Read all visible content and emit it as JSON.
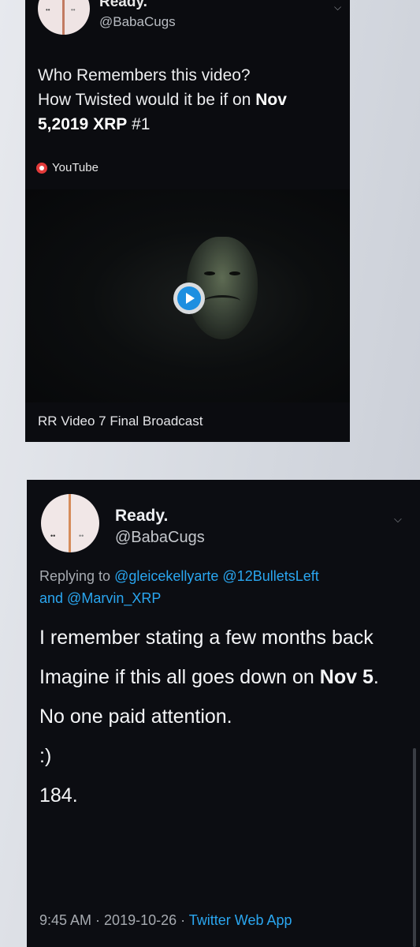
{
  "tweet1": {
    "name": "Ready.",
    "handle": "@BabaCugs",
    "text_line1": "Who Remembers this video?",
    "text_line2_plain": "How Twisted would it be if on ",
    "text_line2_bold": "Nov",
    "text_line3_bold1": "5,2019",
    "text_line3_bold2": "XRP",
    "text_line3_plain": " #1",
    "source_label": "YouTube",
    "video_title": "RR Video 7 Final Broadcast"
  },
  "tweet2": {
    "name": "Ready.",
    "handle": "@BabaCugs",
    "reply_prefix": "Replying to ",
    "reply_mention1": "@gleicekellyarte",
    "reply_mention2": "@12BulletsLeft",
    "reply_and": "and ",
    "reply_mention3": "@Marvin_XRP",
    "line1": "I remember stating a few months back",
    "line2_plain": "Imagine if this all goes down on ",
    "line2_bold": "Nov 5",
    "line2_end": ".",
    "line3": "No one paid attention.",
    "line4": ":)",
    "line5": "184.",
    "time": "9:45 AM",
    "date": "2019-10-26",
    "separator": " · ",
    "app": "Twitter Web App"
  },
  "colors": {
    "card_bg": "#0b0c10",
    "link": "#2aa6f0",
    "youtube": "#e33a3a",
    "play_button": "#1d8fe0"
  },
  "icons": {
    "avatar": "avatar-image",
    "menu": "chevron-down-icon",
    "youtube": "youtube-icon",
    "play": "play-icon"
  }
}
